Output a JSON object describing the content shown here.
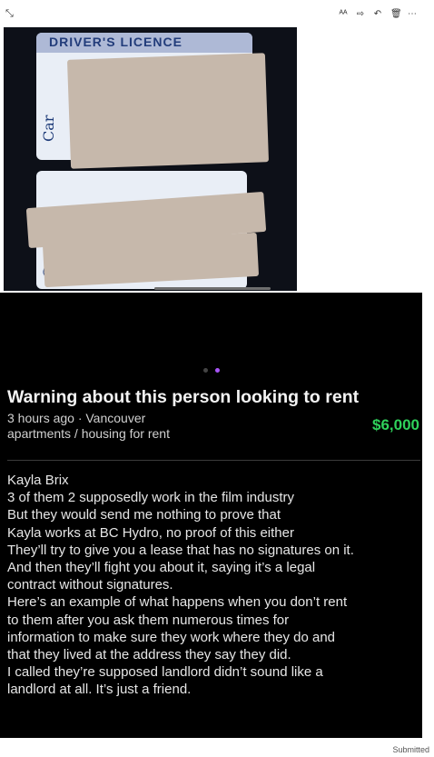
{
  "toolbar": {
    "left_icon": "collapse-arrows-icon",
    "icons": [
      "translate-icon",
      "share-icon",
      "reply-icon",
      "trash-icon",
      "more-icon"
    ]
  },
  "photo": {
    "card_top_heading": "DRIVER'S LICENCE",
    "card_top_side_text": "Car",
    "card_bottom_side_text": "Can"
  },
  "carousel": {
    "count": 2,
    "active": 1
  },
  "listing": {
    "title": "Warning about this person looking to rent",
    "time_location": "3 hours ago · Vancouver",
    "category": "apartments / housing for rent",
    "price": "$6,000",
    "description_lines": [
      "Kayla Brix",
      "3 of them 2 supposedly work in the film industry",
      "But they would send me nothing to prove that",
      "Kayla works at BC Hydro, no proof of this either",
      "They’ll try to give you a lease that has no signatures on it.",
      "And then they’ll fight you about it, saying it’s a legal",
      "contract without signatures.",
      "Here’s an example of what happens when you don’t rent",
      "to them after you ask them numerous times for",
      "information to make sure they work where they do and",
      "that they lived at the address they say they did.",
      "I called they’re supposed landlord didn’t sound like a",
      "landlord at all. It’s just a friend."
    ]
  },
  "footer": {
    "submitted": "Submitted"
  },
  "colors": {
    "price": "#2fd15b",
    "active_dot": "#a855f7",
    "background": "#000000"
  }
}
